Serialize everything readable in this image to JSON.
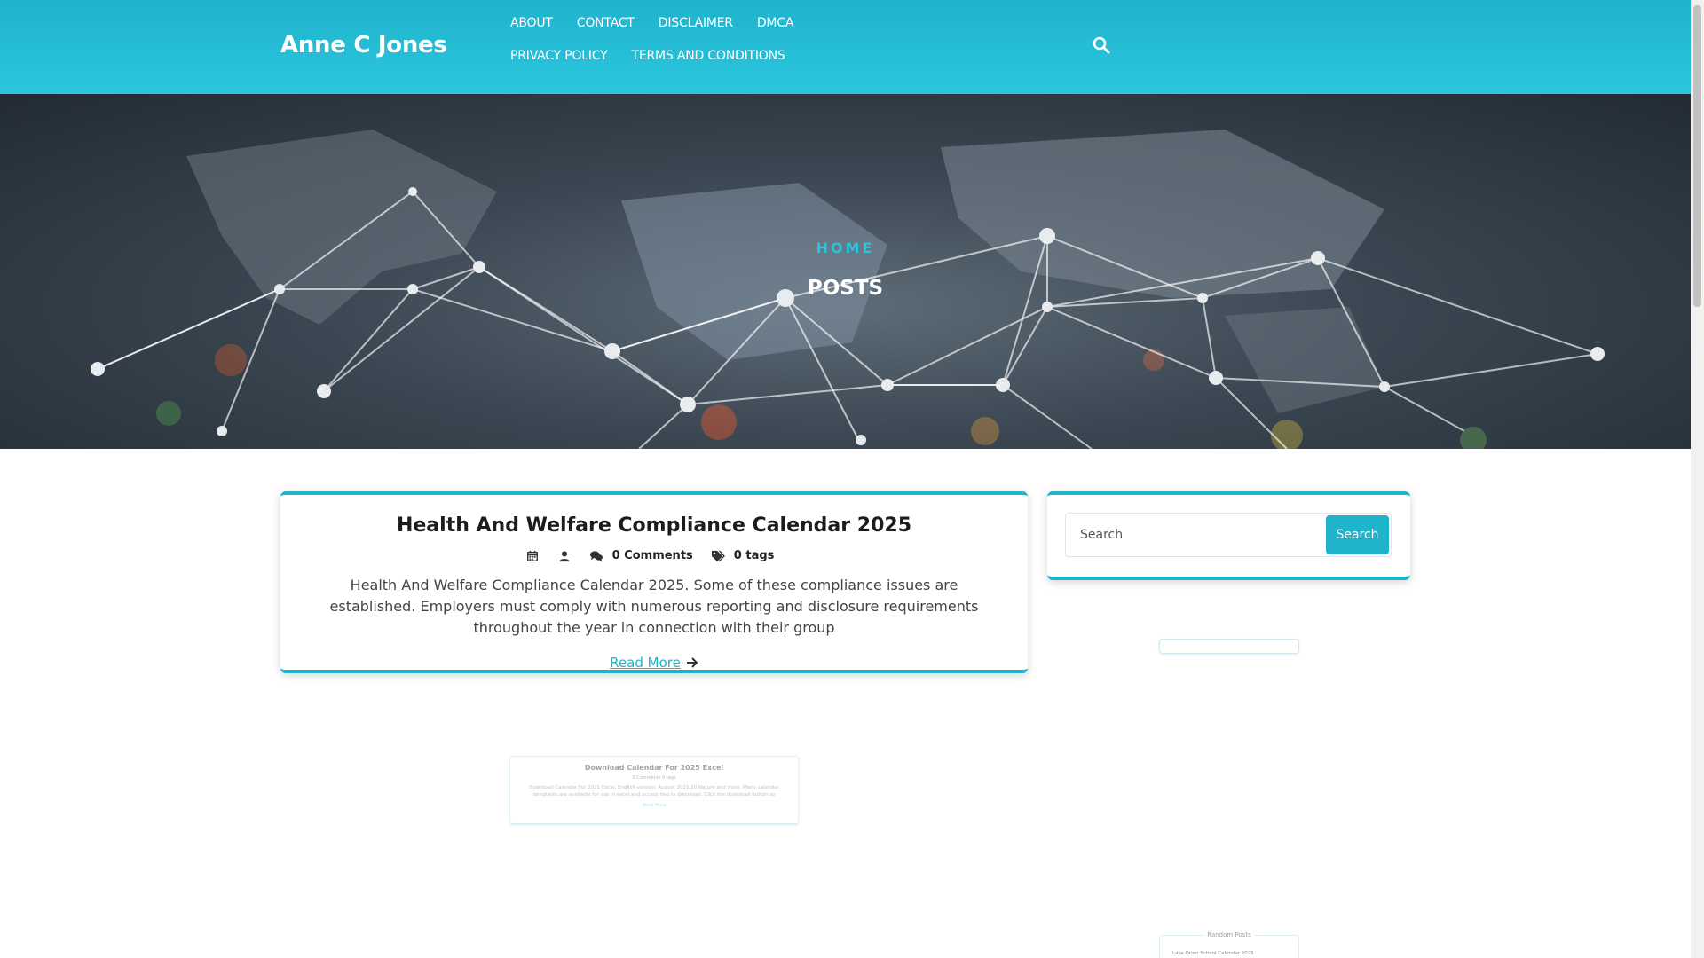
{
  "site": {
    "title": "Anne C Jones"
  },
  "nav": {
    "items": [
      {
        "label": "ABOUT"
      },
      {
        "label": "CONTACT"
      },
      {
        "label": "DISCLAIMER"
      },
      {
        "label": "DMCA"
      },
      {
        "label": "PRIVACY POLICY"
      },
      {
        "label": "TERMS AND CONDITIONS"
      }
    ],
    "search_icon": "search-icon"
  },
  "hero": {
    "breadcrumb": "HOME",
    "heading": "POSTS"
  },
  "post": {
    "title": "Health And Welfare Compliance Calendar 2025",
    "comments": "0 Comments",
    "tags": "0 tags",
    "excerpt": "Health And Welfare Compliance Calendar 2025. Some of these compliance issues are established. Employers must comply with numerous reporting and disclosure requirements throughout the year in connection with their group",
    "read_more": "Read More"
  },
  "sidebar": {
    "search": {
      "placeholder": "Search",
      "button": "Search"
    }
  },
  "preview": {
    "mini_post": {
      "title": "Download Calendar For 2025 Excel",
      "meta": "0 Comments   0 tags",
      "excerpt": "Download Calendar For 2025 Excel. English version: August 2025/20 Nature and more. Many calendar templates are available for use in excel and access free to download. Click the download button so",
      "read_more": "Read More"
    },
    "random_posts": {
      "title": "Random Posts",
      "item": "Lake Orion School Calendar 2025"
    }
  },
  "colors": {
    "accent": "#1fb3cc",
    "header_bg": "#2cc6df",
    "hero_text": "#2fc2dc"
  }
}
